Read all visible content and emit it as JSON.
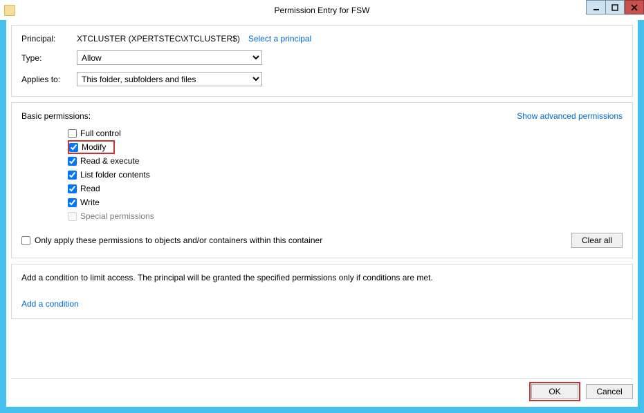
{
  "window": {
    "title": "Permission Entry for FSW"
  },
  "principal": {
    "label": "Principal:",
    "value": "XTCLUSTER (XPERTSTEC\\XTCLUSTER$)",
    "select_link": "Select a principal"
  },
  "type": {
    "label": "Type:",
    "value": "Allow"
  },
  "applies": {
    "label": "Applies to:",
    "value": "This folder, subfolders and files"
  },
  "permissions": {
    "header": "Basic permissions:",
    "show_advanced": "Show advanced permissions",
    "items": [
      {
        "label": "Full control",
        "checked": false,
        "disabled": false,
        "highlight": false
      },
      {
        "label": "Modify",
        "checked": true,
        "disabled": false,
        "highlight": true
      },
      {
        "label": "Read & execute",
        "checked": true,
        "disabled": false,
        "highlight": false
      },
      {
        "label": "List folder contents",
        "checked": true,
        "disabled": false,
        "highlight": false
      },
      {
        "label": "Read",
        "checked": true,
        "disabled": false,
        "highlight": false
      },
      {
        "label": "Write",
        "checked": true,
        "disabled": false,
        "highlight": false
      },
      {
        "label": "Special permissions",
        "checked": false,
        "disabled": true,
        "highlight": false
      }
    ],
    "only_apply": {
      "label": "Only apply these permissions to objects and/or containers within this container",
      "checked": false
    },
    "clear_all": "Clear all"
  },
  "condition": {
    "text": "Add a condition to limit access. The principal will be granted the specified permissions only if conditions are met.",
    "add_link": "Add a condition"
  },
  "buttons": {
    "ok": "OK",
    "cancel": "Cancel"
  }
}
